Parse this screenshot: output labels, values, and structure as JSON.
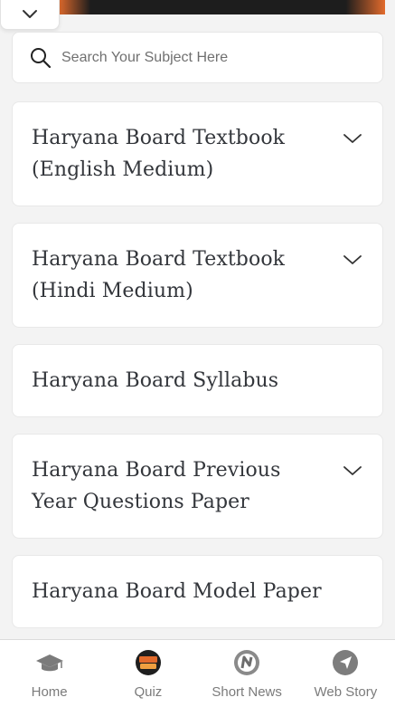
{
  "search": {
    "placeholder": "Search Your Subject Here"
  },
  "cards": [
    {
      "label": "Haryana Board Textbook (English Medium)",
      "expandable": true
    },
    {
      "label": "Haryana Board Textbook (Hindi Medium)",
      "expandable": true
    },
    {
      "label": "Haryana Board Syllabus",
      "expandable": false
    },
    {
      "label": "Haryana Board Previous Year Questions Paper",
      "expandable": true
    },
    {
      "label": "Haryana Board Model Paper",
      "expandable": false
    }
  ],
  "bottom_nav": [
    {
      "label": "Home",
      "icon": "graduation-cap-icon"
    },
    {
      "label": "Quiz",
      "icon": "quiz-time-icon"
    },
    {
      "label": "Short News",
      "icon": "news-n-icon"
    },
    {
      "label": "Web Story",
      "icon": "navigation-arrow-icon"
    }
  ],
  "colors": {
    "accent": "#e36b2c",
    "text": "#33363b",
    "muted": "#7b7b7b"
  }
}
